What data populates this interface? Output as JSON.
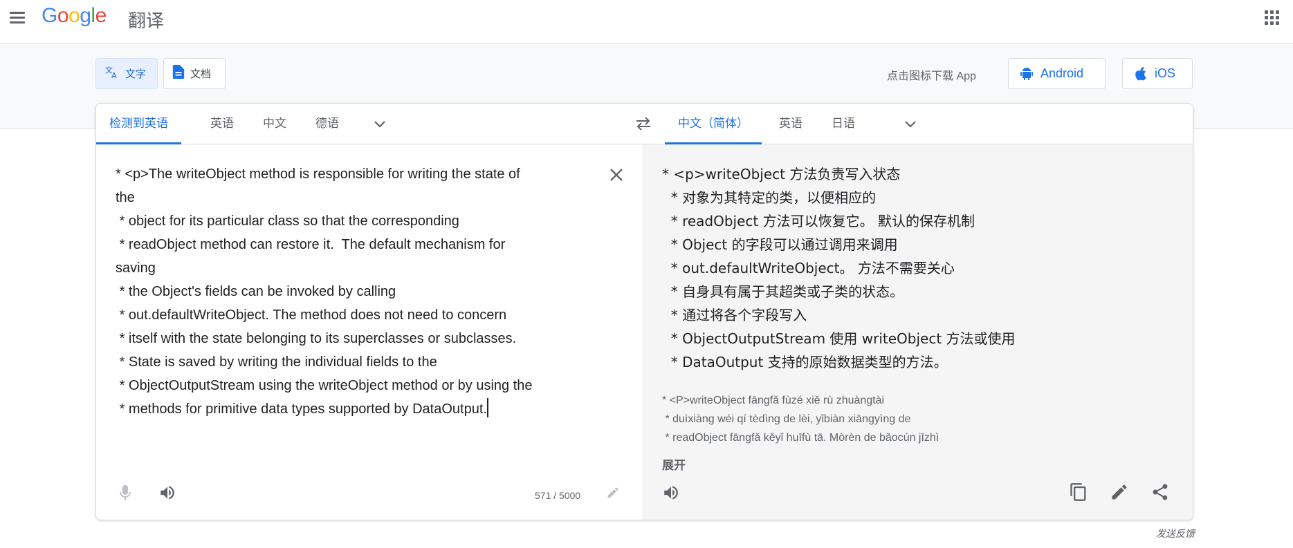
{
  "header": {
    "logo": "Google",
    "product": "翻译"
  },
  "modes": {
    "text_label": "文字",
    "doc_label": "文档"
  },
  "apps": {
    "prompt": "点击图标下载 App",
    "android_label": "Android",
    "ios_label": "iOS"
  },
  "source_langs": {
    "items": [
      "检测到英语",
      "英语",
      "中文",
      "德语"
    ],
    "active_index": 0
  },
  "target_langs": {
    "items": [
      "中文（简体）",
      "英语",
      "日语"
    ],
    "active_index": 0
  },
  "source": {
    "text": "* <p>The writeObject method is responsible for writing the state of\nthe\n * object for its particular class so that the corresponding\n * readObject method can restore it.  The default mechanism for\nsaving\n * the Object's fields can be invoked by calling\n * out.defaultWriteObject. The method does not need to concern\n * itself with the state belonging to its superclasses or subclasses.\n * State is saved by writing the individual fields to the\n * ObjectOutputStream using the writeObject method or by using the\n * methods for primitive data types supported by DataOutput.",
    "char_count": "571 / 5000"
  },
  "target": {
    "text": "* <p>writeObject 方法负责写入状态\n  * 对象为其特定的类，以便相应的\n  * readObject 方法可以恢复它。 默认的保存机制\n  * Object 的字段可以通过调用来调用\n  * out.defaultWriteObject。 方法不需要关心\n  * 自身具有属于其超类或子类的状态。\n  * 通过将各个字段写入\n  * ObjectOutputStream 使用 writeObject 方法或使用\n  * DataOutput 支持的原始数据类型的方法。",
    "transliteration": "* <P>writeObject fāngfǎ fùzé xiě rù zhuàngtài\n * duìxiàng wéi qí tèdìng de lèi, yǐbiàn xiāngyìng de\n * readObject fāngfǎ kěyǐ huīfù tā. Mòrèn de bǎocún jīzhì",
    "expand_label": "展开"
  },
  "footer": {
    "feedback": "发送反馈"
  },
  "colors": {
    "accent": "#1a73e8",
    "icon_gray": "#5f6368",
    "target_bg": "#f5f5f5"
  }
}
